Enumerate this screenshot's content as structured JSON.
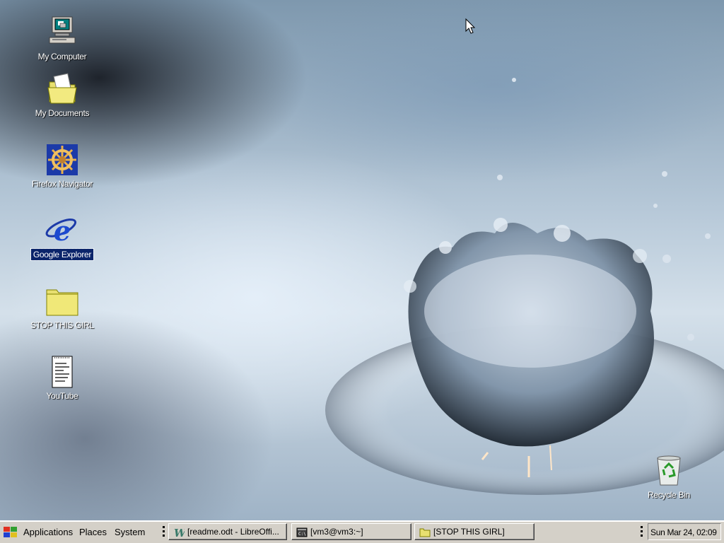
{
  "desktop": {
    "icons": [
      {
        "label": "My Computer",
        "icon": "computer-icon"
      },
      {
        "label": "My Documents",
        "icon": "documents-folder-icon"
      },
      {
        "label": "Firefox Navigator",
        "icon": "ship-wheel-icon"
      },
      {
        "label": "Google Explorer",
        "icon": "internet-explorer-icon",
        "selected": true
      },
      {
        "label": "STOP THIS GIRL",
        "icon": "folder-icon"
      },
      {
        "label": "YouTube",
        "icon": "text-document-icon"
      },
      {
        "label": "Recycle Bin",
        "icon": "recycle-bin-icon"
      }
    ]
  },
  "taskbar": {
    "menus": [
      "Applications",
      "Places",
      "System"
    ],
    "tasks": [
      {
        "label": "[readme.odt - LibreOffi...",
        "icon": "writer-icon"
      },
      {
        "label": "[vm3@vm3:~]",
        "icon": "terminal-icon"
      },
      {
        "label": "[STOP THIS GIRL]",
        "icon": "folder-icon"
      }
    ],
    "clock": "Sun Mar 24, 02:09"
  },
  "colors": {
    "selection": "#0a246a",
    "taskbar": "#d4d0c8",
    "folder": "#e8e070"
  }
}
